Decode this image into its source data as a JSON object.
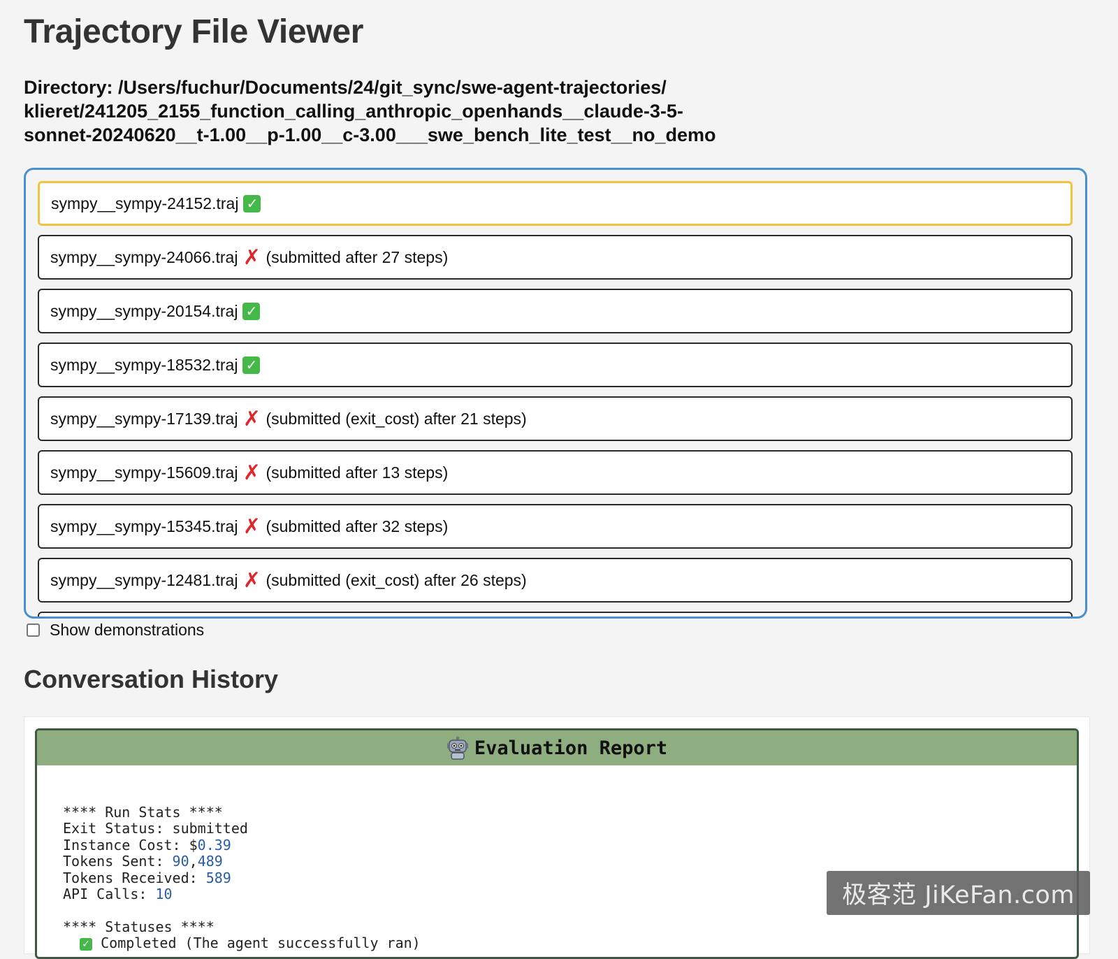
{
  "page": {
    "title": "Trajectory File Viewer",
    "directory_lines": [
      "Directory: /Users/fuchur/Documents/24/git_sync/swe-agent-trajectories/",
      "klieret/241205_2155_function_calling_anthropic_openhands__claude-3-5-",
      "sonnet-20240620__t-1.00__p-1.00__c-3.00___swe_bench_lite_test__no_demo"
    ]
  },
  "files": [
    {
      "name": "sympy__sympy-24152.traj",
      "status": "resolved",
      "icon": "check-icon",
      "note": ""
    },
    {
      "name": "sympy__sympy-24066.traj",
      "status": "failed",
      "icon": "cross-icon",
      "note": "(submitted after 27 steps)"
    },
    {
      "name": "sympy__sympy-20154.traj",
      "status": "resolved",
      "icon": "check-icon",
      "note": ""
    },
    {
      "name": "sympy__sympy-18532.traj",
      "status": "resolved",
      "icon": "check-icon",
      "note": ""
    },
    {
      "name": "sympy__sympy-17139.traj",
      "status": "failed",
      "icon": "cross-icon",
      "note": "(submitted (exit_cost) after 21 steps)"
    },
    {
      "name": "sympy__sympy-15609.traj",
      "status": "failed",
      "icon": "cross-icon",
      "note": "(submitted after 13 steps)"
    },
    {
      "name": "sympy__sympy-15345.traj",
      "status": "failed",
      "icon": "cross-icon",
      "note": "(submitted after 32 steps)"
    },
    {
      "name": "sympy__sympy-12481.traj",
      "status": "failed",
      "icon": "cross-icon",
      "note": "(submitted (exit_cost) after 26 steps)"
    }
  ],
  "selected_file_index": 0,
  "demo_toggle": {
    "label": "Show demonstrations",
    "checked": false
  },
  "conversation": {
    "heading": "Conversation History",
    "report": {
      "title": "Evaluation Report",
      "icon": "robot-icon",
      "run_stats_heading": "**** Run Stats ****",
      "exit_status_label": "Exit Status: ",
      "exit_status_value": "submitted",
      "instance_cost_label": "Instance Cost: ",
      "instance_cost_currency": "$",
      "instance_cost_value": "0.39",
      "tokens_sent_label": "Tokens Sent: ",
      "tokens_sent_value_a": "90",
      "tokens_sent_comma": ",",
      "tokens_sent_value_b": "489",
      "tokens_received_label": "Tokens Received: ",
      "tokens_received_value": "589",
      "api_calls_label": "API Calls: ",
      "api_calls_value": "10",
      "statuses_heading": "**** Statuses ****",
      "status_line": "Completed (The agent successfully ran)"
    }
  },
  "watermark": {
    "text": "极客范 JiKeFan.com"
  },
  "colors": {
    "list_border": "#4a90d0",
    "selected_border": "#f2c33e",
    "check_green": "#44b848",
    "cross_red": "#e0262b",
    "report_header": "#8fae80",
    "number_blue": "#2a5da8"
  }
}
